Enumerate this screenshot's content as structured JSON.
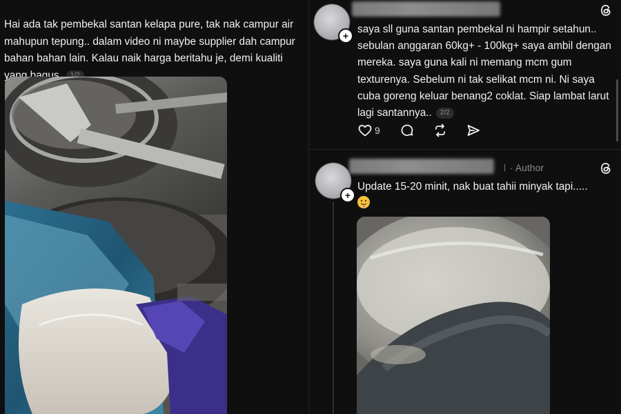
{
  "left_post": {
    "text": "Hai ada tak pembekal santan kelapa pure, tak nak campur air mahupun tepung.. dalam video ni maybe supplier dah campur bahan bahan lain. Kalau naik harga beritahu je, demi kualiti yang bagus.",
    "pager": "1/2",
    "image_icon": "photo-coconut-milk-bag"
  },
  "reply": {
    "text": "saya sll guna santan pembekal ni hampir setahun.. sebulan anggaran 60kg+ - 100kg+ saya ambil dengan mereka. saya guna kali ni memang mcm gum texturenya. Sebelum ni tak selikat mcm ni. Ni saya cuba goreng keluar benang2 coklat. Siap lambat larut lagi santannya..",
    "pager": "2/2",
    "like_count": "9",
    "icons": [
      "heart-icon",
      "comment-icon",
      "repost-icon",
      "share-icon",
      "threads-logo-icon"
    ]
  },
  "author_reply": {
    "name_trail": "l",
    "author_label": "· Author",
    "text": "Update 15-20 minit, nak buat tahii minyak tapi.....",
    "emoji": "smiling-face-emoji",
    "image_icon": "photo-pot-closeup"
  },
  "colors": {
    "background": "#0f0f0f",
    "text": "#f1f1f1",
    "muted": "#8a8a8a"
  }
}
